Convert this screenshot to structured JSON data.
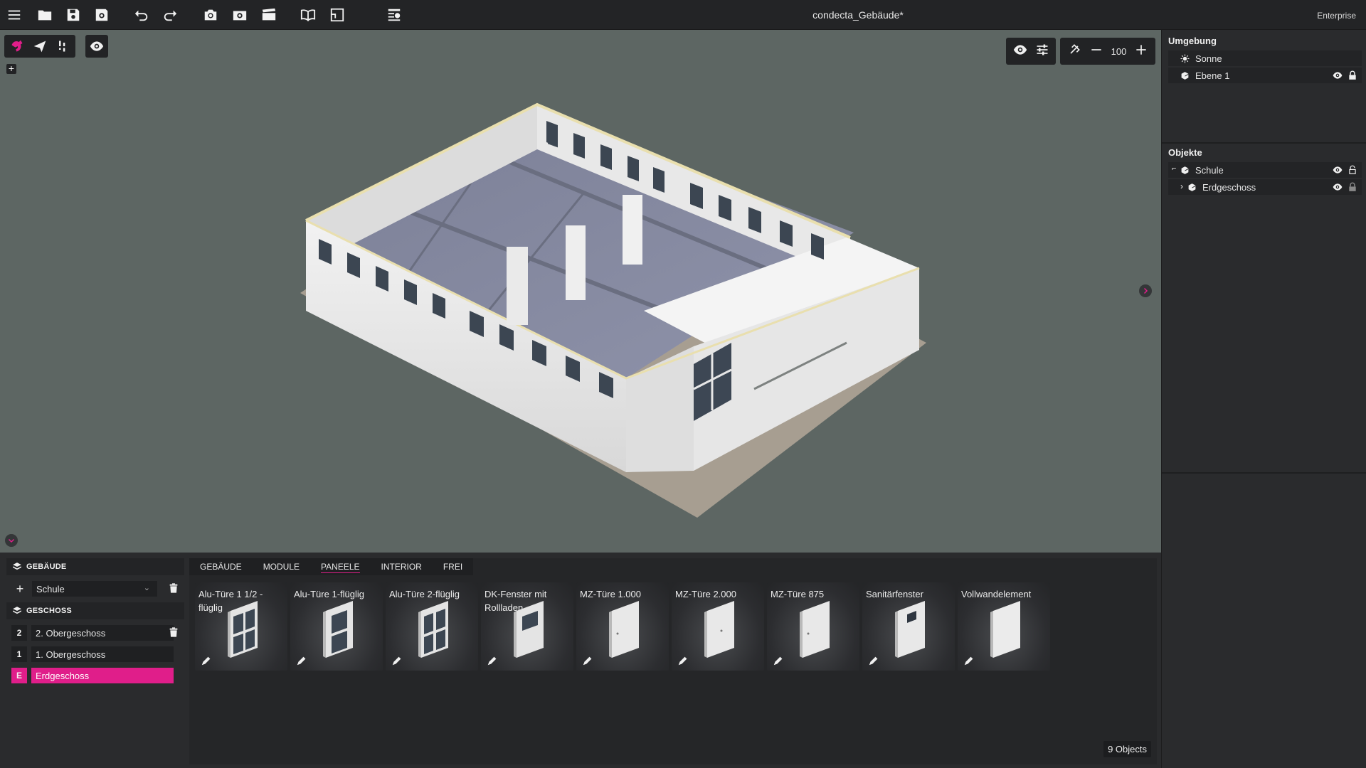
{
  "app": {
    "title": "condecta_Gebäude*",
    "edition": "Enterprise"
  },
  "toolbar": {
    "icons": [
      "menu-icon",
      "open-folder-icon",
      "save-icon",
      "save-settings-icon",
      "undo-icon",
      "redo-icon",
      "camera-icon",
      "camera-settings-icon",
      "clapperboard-icon",
      "book-icon",
      "floorplan-icon",
      "task-list-icon"
    ]
  },
  "viewport": {
    "zoom": "100",
    "left_tools": [
      "pointer-tool-icon",
      "paper-plane-icon",
      "walk-icon",
      "eye-icon"
    ],
    "plus_label": "+"
  },
  "environment_panel": {
    "heading": "Umgebung",
    "items": [
      {
        "label": "Sonne",
        "icon": "sun-icon"
      },
      {
        "label": "Ebene 1",
        "icon": "cube-icon"
      }
    ]
  },
  "objects_panel": {
    "heading": "Objekte",
    "items": [
      {
        "label": "Schule",
        "icon": "cube-icon"
      },
      {
        "label": "Erdgeschoss",
        "icon": "cube-icon"
      }
    ]
  },
  "building_dock": {
    "building_heading": "GEBÄUDE",
    "building_select": "Schule",
    "floor_heading": "GESCHOSS",
    "floors": [
      {
        "num": "2",
        "label": "2. Obergeschoss"
      },
      {
        "num": "1",
        "label": "1. Obergeschoss"
      },
      {
        "num": "E",
        "label": "Erdgeschoss"
      }
    ]
  },
  "library": {
    "tabs": [
      "GEBÄUDE",
      "MODULE",
      "PANEELE",
      "INTERIOR",
      "FREI"
    ],
    "active_tab": "PANEELE",
    "items": [
      {
        "label": "Alu-Türe 1 1/2 -flüglig"
      },
      {
        "label": "Alu-Türe 1-flüglig"
      },
      {
        "label": "Alu-Türe 2-flüglig"
      },
      {
        "label": "DK-Fenster mit Rollladen"
      },
      {
        "label": "MZ-Türe 1.000"
      },
      {
        "label": "MZ-Türe 2.000"
      },
      {
        "label": "MZ-Türe 875"
      },
      {
        "label": "Sanitärfenster"
      },
      {
        "label": "Vollwandelement"
      }
    ],
    "count": "9 Objects"
  },
  "colors": {
    "accent": "#e01e8a",
    "viewport_bg": "#5d6663",
    "panel_bg": "#2a2b2d"
  }
}
